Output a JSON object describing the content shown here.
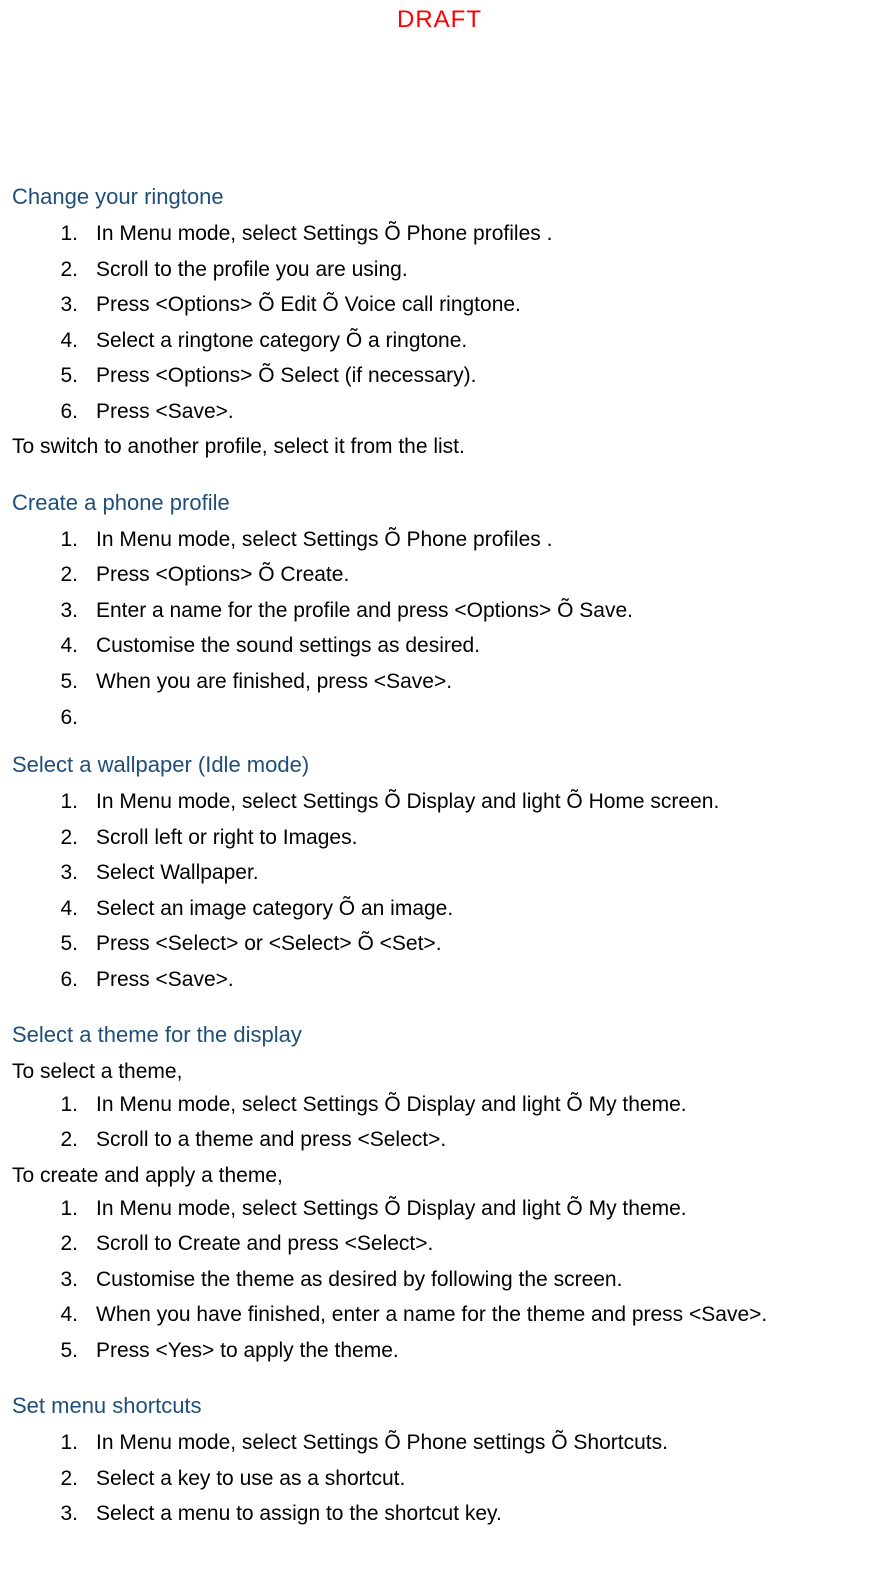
{
  "draft_label": "DRAFT",
  "sections": {
    "s1": {
      "heading": "Change your ringtone",
      "items": [
        "In Menu mode, select Settings Õ Phone profiles .",
        "Scroll to the profile you are using.",
        "Press <Options> Õ Edit Õ Voice call ringtone.",
        "Select a ringtone category Õ a ringtone.",
        "Press <Options> Õ Select (if necessary).",
        "Press <Save>."
      ],
      "trailer": "To switch to another profile, select it from the list."
    },
    "s2": {
      "heading": "Create a phone profile",
      "items": [
        "In Menu mode, select Settings Õ Phone profiles .",
        "Press <Options> Õ Create.",
        "Enter a name for the profile and press <Options> Õ Save.",
        "Customise the sound settings as desired.",
        "When you are finished, press <Save>.",
        ""
      ]
    },
    "s3": {
      "heading": "Select a wallpaper (Idle mode)",
      "items": [
        "In Menu mode, select Settings Õ Display and light Õ Home screen.",
        "Scroll left or right to Images.",
        "Select Wallpaper.",
        "Select an image category Õ an image.",
        "Press <Select> or <Select> Õ <Set>.",
        "Press <Save>."
      ]
    },
    "s4": {
      "heading": "Select a theme for the display",
      "intro_a": "To select a theme,",
      "items_a": [
        "In Menu mode, select Settings Õ Display and light Õ My theme.",
        "Scroll to a theme and press <Select>."
      ],
      "intro_b": "To create and apply a theme,",
      "items_b": [
        "In Menu mode, select Settings Õ Display and light Õ My theme.",
        "Scroll to Create and press <Select>.",
        "Customise the theme as desired by following the screen.",
        "When you have finished, enter a name for the theme and press <Save>.",
        "Press <Yes> to apply the theme."
      ]
    },
    "s5": {
      "heading": "Set menu shortcuts",
      "items": [
        "In Menu mode, select Settings Õ Phone settings Õ Shortcuts.",
        "Select a key to use as a shortcut.",
        "Select a menu to assign to the shortcut key."
      ]
    }
  }
}
